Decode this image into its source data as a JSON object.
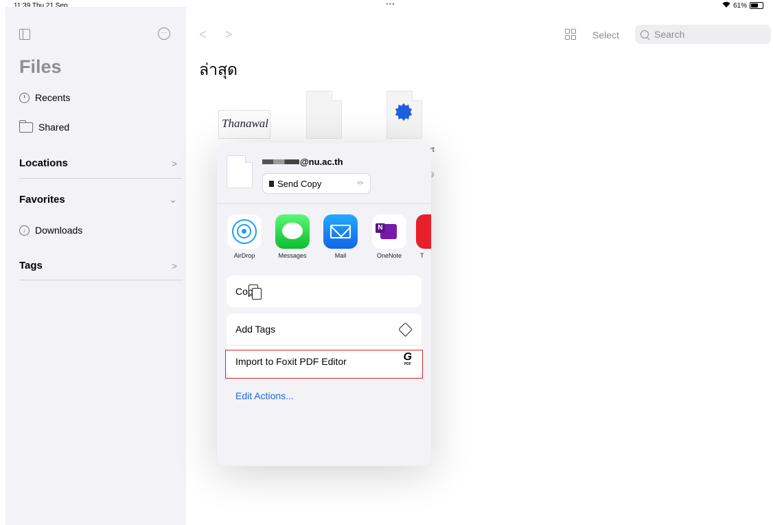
{
  "status_bar": {
    "time": "11:39  Thu 21 Sep",
    "dots": "•••",
    "battery_pct": "61%",
    "battery_fill": 0.61
  },
  "sidebar": {
    "title": "Files",
    "recents": "Recents",
    "shared": "Shared",
    "locations": "Locations",
    "favorites": "Favorites",
    "downloads": "Downloads",
    "tags": "Tags",
    "chevron_right": ">",
    "chevron_down": "⌄"
  },
  "toolbar": {
    "back": "<",
    "forward": ">",
    "select_label": "Select",
    "search_placeholder": "Search"
  },
  "main": {
    "title": "ล่าสุด",
    "signature_text": "Thanawal",
    "peek_rt": "rt",
    "peek_9": "9"
  },
  "share_sheet": {
    "recipient_suffix": "@nu.ac.th",
    "send_mode": "Send Copy",
    "apps": [
      {
        "label": "AirDrop",
        "icon": "airdrop-icon"
      },
      {
        "label": "Messages",
        "icon": "messages-icon"
      },
      {
        "label": "Mail",
        "icon": "mail-icon"
      },
      {
        "label": "OneNote",
        "icon": "onenote-icon"
      },
      {
        "label": "T",
        "icon": "partial-app-icon"
      }
    ],
    "onenote_letter": "N",
    "actions": {
      "copy": "Copy",
      "add_tags": "Add Tags",
      "import_foxit": "Import to Foxit PDF Editor",
      "foxit_glyph": "G",
      "foxit_sub": "PDF"
    },
    "edit_actions": "Edit Actions..."
  }
}
